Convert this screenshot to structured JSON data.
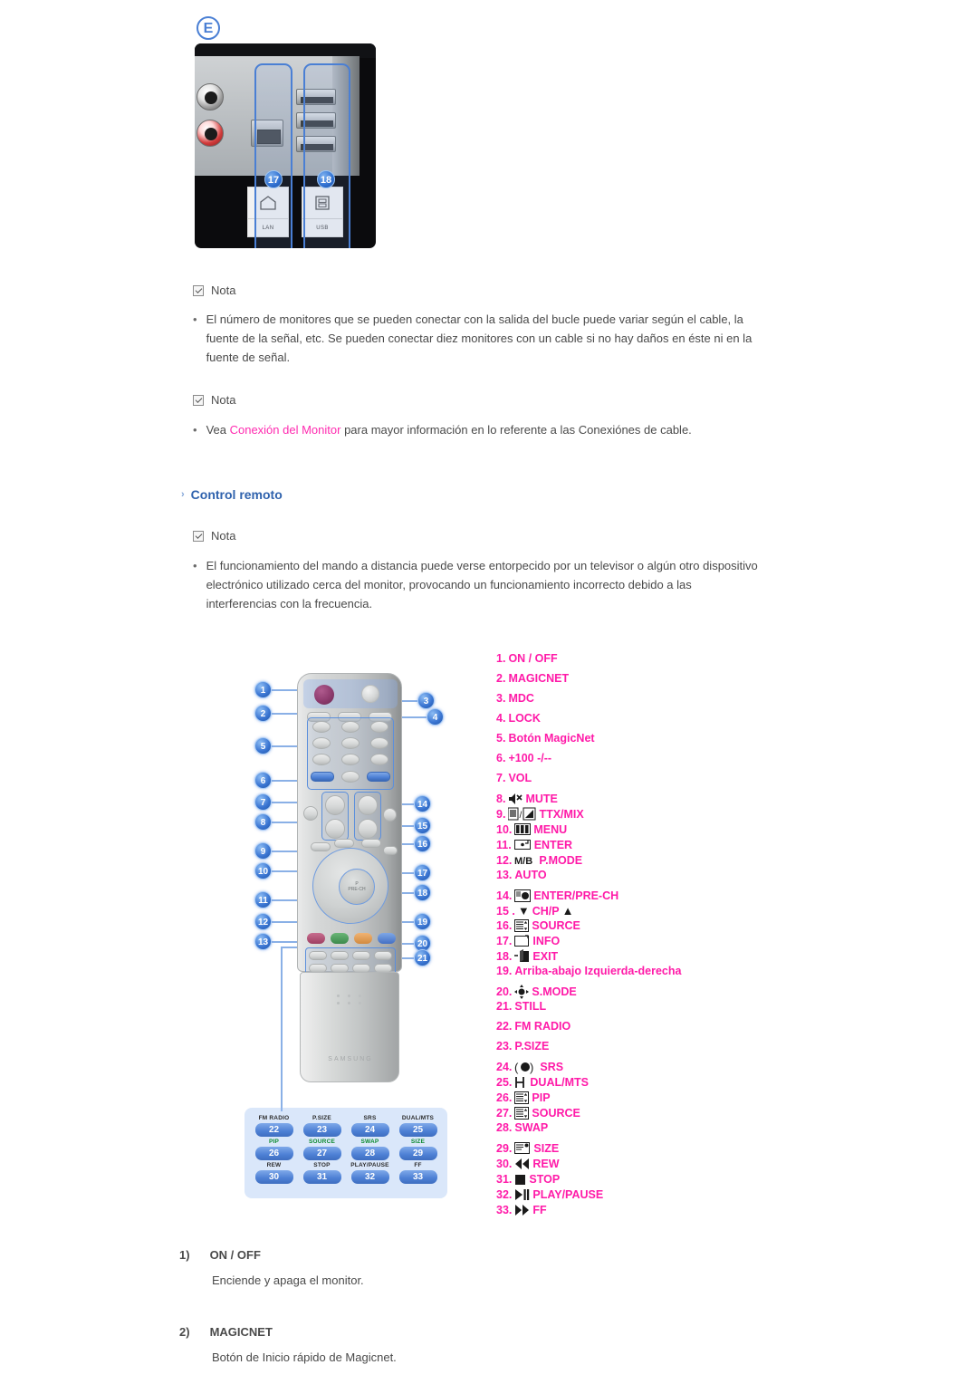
{
  "connector_figure": {
    "letter": "E",
    "callouts": [
      {
        "num": "17",
        "port_label": "LAN",
        "icon": "lan-icon"
      },
      {
        "num": "18",
        "port_label": "USB",
        "icon": "usb-icon"
      }
    ]
  },
  "notes": [
    {
      "label": "Nota",
      "bullet": "El número de monitores que se pueden conectar con la salida del bucle puede variar según el cable, la fuente de la señal, etc. Se pueden conectar diez monitores con un cable si no hay daños en éste ni en la fuente de señal."
    },
    {
      "label": "Nota",
      "bullet_pre": "Vea ",
      "bullet_link": "Conexión del Monitor",
      "bullet_post": " para mayor información en lo referente a las Conexiónes de cable."
    }
  ],
  "section": {
    "arrow": "›",
    "title": "Control remoto"
  },
  "remote_note": {
    "label": "Nota",
    "bullet": "El funcionamiento del mando a distancia puede verse entorpecido por un televisor o algún otro dispositivo electrónico utilizado cerca del monitor, provocando un funcionamiento incorrecto debido a las interferencias con la frecuencia."
  },
  "remote_figure": {
    "brand": "SAMSUNG",
    "nav_center_label": "P\nPRE-CH",
    "left_callouts": [
      "1",
      "2",
      "5",
      "6",
      "7",
      "8",
      "9",
      "10",
      "11",
      "12",
      "13"
    ],
    "right_callouts": [
      "3",
      "4",
      "14",
      "15",
      "16",
      "17",
      "18",
      "19",
      "20",
      "21"
    ],
    "button_grid": [
      [
        {
          "cap": "FM RADIO",
          "num": "22",
          "green": false
        },
        {
          "cap": "P.SIZE",
          "num": "23",
          "green": false
        },
        {
          "cap": "SRS",
          "num": "24",
          "green": false
        },
        {
          "cap": "DUAL/MTS",
          "num": "25",
          "green": false
        }
      ],
      [
        {
          "cap": "PIP",
          "num": "26",
          "green": true
        },
        {
          "cap": "SOURCE",
          "num": "27",
          "green": true
        },
        {
          "cap": "SWAP",
          "num": "28",
          "green": true
        },
        {
          "cap": "SIZE",
          "num": "29",
          "green": true
        }
      ],
      [
        {
          "cap": "REW",
          "num": "30",
          "green": false
        },
        {
          "cap": "STOP",
          "num": "31",
          "green": false
        },
        {
          "cap": "PLAY/PAUSE",
          "num": "32",
          "green": false
        },
        {
          "cap": "FF",
          "num": "33",
          "green": false
        }
      ]
    ]
  },
  "legend": [
    {
      "n": "1.",
      "label": "ON / OFF",
      "icon": null,
      "spaced": true
    },
    {
      "n": "2.",
      "label": "MAGICNET",
      "icon": null,
      "spaced": true
    },
    {
      "n": "3.",
      "label": "MDC",
      "icon": null,
      "spaced": true
    },
    {
      "n": "4.",
      "label": "LOCK",
      "icon": null,
      "spaced": true
    },
    {
      "n": "5.",
      "label": "Botón MagicNet",
      "icon": null,
      "spaced": true
    },
    {
      "n": "6.",
      "label": "+100 -/--",
      "icon": null,
      "spaced": true
    },
    {
      "n": "7.",
      "label": "VOL",
      "icon": null,
      "spaced": true
    },
    {
      "n": "8.",
      "label": "MUTE",
      "icon": "mute-icon",
      "spaced": false
    },
    {
      "n": "9.",
      "label": "TTX/MIX",
      "icon": "ttx-mix-icon",
      "spaced": false
    },
    {
      "n": "10.",
      "label": "MENU",
      "icon": "menu-icon",
      "spaced": false
    },
    {
      "n": "11.",
      "label": "ENTER",
      "icon": "enter-icon",
      "spaced": false
    },
    {
      "n": "12.",
      "label": "P.MODE",
      "icon": "mb-icon",
      "spaced": false
    },
    {
      "n": "13.",
      "label": "AUTO",
      "icon": null,
      "spaced": true
    },
    {
      "n": "14.",
      "label": "ENTER/PRE-CH",
      "icon": "pre-ch-icon",
      "spaced": false
    },
    {
      "n": "15 .",
      "label": "CH/P",
      "icon": "chp-icon",
      "spaced": false
    },
    {
      "n": "16.",
      "label": "SOURCE",
      "icon": "source-icon",
      "spaced": false
    },
    {
      "n": "17.",
      "label": "INFO",
      "icon": "info-icon",
      "spaced": false
    },
    {
      "n": "18.",
      "label": "EXIT",
      "icon": "exit-icon",
      "spaced": false
    },
    {
      "n": "19.",
      "label": "Arriba-abajo Izquierda-derecha",
      "icon": null,
      "spaced": true
    },
    {
      "n": "20.",
      "label": "S.MODE",
      "icon": "s-mode-icon",
      "spaced": false
    },
    {
      "n": "21.",
      "label": "STILL",
      "icon": null,
      "spaced": true
    },
    {
      "n": "22.",
      "label": "FM RADIO",
      "icon": null,
      "spaced": true
    },
    {
      "n": "23.",
      "label": "P.SIZE",
      "icon": null,
      "spaced": true
    },
    {
      "n": "24.",
      "label": "SRS",
      "icon": "srs-icon",
      "spaced": false
    },
    {
      "n": "25.",
      "label": "DUAL/MTS",
      "icon": "dual-mts-icon",
      "spaced": false
    },
    {
      "n": "26.",
      "label": "PIP",
      "icon": "pip-icon",
      "spaced": false
    },
    {
      "n": "27.",
      "label": "SOURCE",
      "icon": "source-icon",
      "spaced": false
    },
    {
      "n": "28.",
      "label": "SWAP",
      "icon": null,
      "spaced": true
    },
    {
      "n": "29.",
      "label": "SIZE",
      "icon": "size-icon",
      "spaced": false
    },
    {
      "n": "30.",
      "label": "REW",
      "icon": "rew-icon",
      "spaced": false
    },
    {
      "n": "31.",
      "label": "STOP",
      "icon": "stop-icon",
      "spaced": false
    },
    {
      "n": "32.",
      "label": "PLAY/PAUSE",
      "icon": "play-pause-icon",
      "spaced": false
    },
    {
      "n": "33.",
      "label": "FF",
      "icon": "ff-icon",
      "spaced": false
    }
  ],
  "descriptions": [
    {
      "num": "1)",
      "title": "ON / OFF",
      "text": "Enciende y apaga el monitor."
    },
    {
      "num": "2)",
      "title": "MAGICNET",
      "text": "Botón de Inicio rápido de Magicnet."
    }
  ],
  "colors": {
    "magenta": "#ff1aa8",
    "heading_blue": "#2f62ad",
    "callout_blue": "#3a75d2",
    "body_gray": "#4a4a4a",
    "green_caption": "#0c8a2f"
  }
}
